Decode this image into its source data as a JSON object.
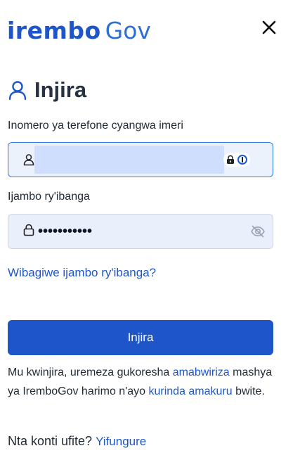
{
  "brand": {
    "word": "irembo",
    "suffix": "Gov",
    "color": "#1e56c9"
  },
  "header": {
    "close_icon": "close-icon"
  },
  "form": {
    "title": "Injira",
    "title_icon": "user-icon",
    "phone_label": "Inomero ya terefone cyangwa imeri",
    "phone_value": "",
    "password_label": "Ijambo ry'ibanga",
    "password_value": "•••••••••••",
    "forgot_link": "Wibagiwe ijambo ry'ibanga?",
    "submit_label": "Injira"
  },
  "terms": {
    "part1": "Mu kwinjira, uremeza gukoresha ",
    "link1": "amabwiriza",
    "part2": " mashya ya IremboGov harimo n'ayo ",
    "link2": "kurinda amakuru",
    "part3": " bwite."
  },
  "signup": {
    "prompt": "Nta konti ufite?",
    "link": "Yifungure"
  },
  "colors": {
    "accent": "#1e56c9",
    "focus_border": "#2c7be5",
    "field_bg": "#e9effb"
  }
}
